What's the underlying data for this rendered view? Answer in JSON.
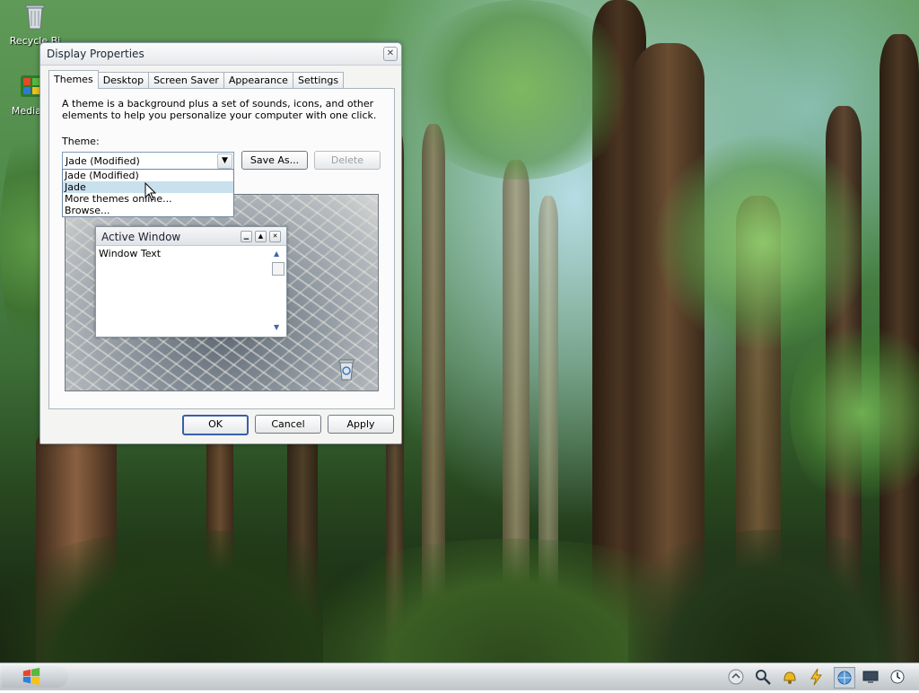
{
  "desktop": {
    "icons": [
      {
        "label": "Recycle Bi",
        "icon": "recycle-bin-icon"
      },
      {
        "label": "Media C",
        "icon": "media-center-icon"
      }
    ]
  },
  "dialog": {
    "title": "Display Properties",
    "close_glyph": "✕",
    "tabs": [
      "Themes",
      "Desktop",
      "Screen Saver",
      "Appearance",
      "Settings"
    ],
    "active_tab": "Themes",
    "description": "A theme is a background plus a set of sounds, icons, and other elements to help you personalize your computer with one click.",
    "theme_label": "Theme:",
    "theme_selected": "Jade (Modified)",
    "theme_options": [
      "Jade (Modified)",
      "Jade",
      "More themes online...",
      "Browse..."
    ],
    "highlighted_option": "Jade",
    "save_as_label": "Save As...",
    "delete_label": "Delete",
    "preview": {
      "window_title": "Active Window",
      "window_text": "Window Text"
    },
    "ok_label": "OK",
    "cancel_label": "Cancel",
    "apply_label": "Apply"
  },
  "taskbar": {
    "start_icon": "windows-logo-icon",
    "tray_icons": [
      "tray-scroll-icon",
      "search-icon",
      "bell-icon",
      "lightning-icon",
      "globe-icon",
      "monitor-icon",
      "clock-icon"
    ]
  },
  "colors": {
    "accent": "#3a5fa8",
    "highlight": "#c9e0ee"
  }
}
